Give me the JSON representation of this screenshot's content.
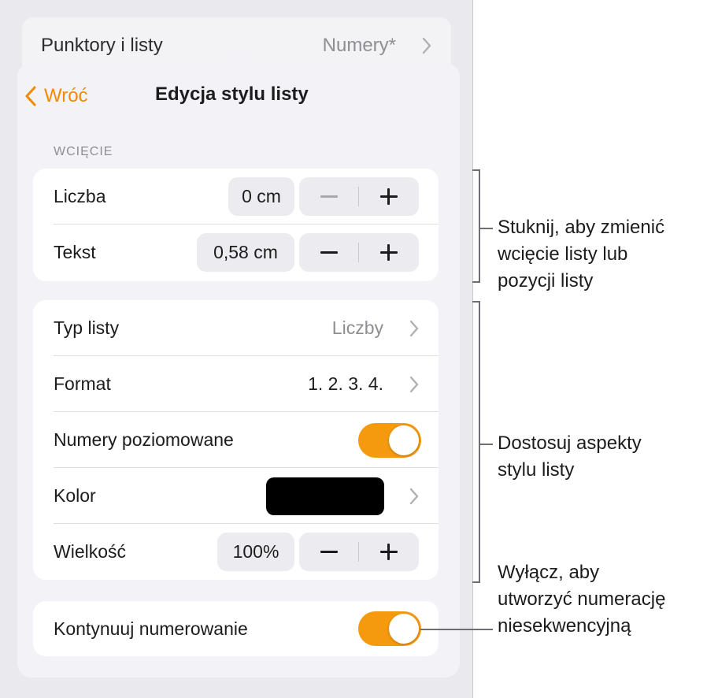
{
  "background_row": {
    "label": "Punktory i listy",
    "value": "Numery*"
  },
  "nav": {
    "back_label": "Wróć",
    "title": "Edycja stylu listy"
  },
  "indent_section": {
    "header": "WCIĘCIE",
    "rows": [
      {
        "label": "Liczba",
        "value": "0 cm",
        "minus_enabled": false
      },
      {
        "label": "Tekst",
        "value": "0,58 cm",
        "minus_enabled": true
      }
    ]
  },
  "style_section": {
    "list_type": {
      "label": "Typ listy",
      "value": "Liczby"
    },
    "format": {
      "label": "Format",
      "value": "1. 2. 3. 4."
    },
    "tiered": {
      "label": "Numery poziomowane",
      "on": true
    },
    "color": {
      "label": "Kolor",
      "value": "#000000"
    },
    "size": {
      "label": "Wielkość",
      "value": "100%"
    }
  },
  "continue": {
    "label": "Kontynuuj numerowanie",
    "on": true
  },
  "callouts": {
    "indent": [
      "Stuknij, aby zmienić",
      "wcięcie listy lub",
      "pozycji listy"
    ],
    "style": [
      "Dostosuj aspekty",
      "stylu listy"
    ],
    "continue": [
      "Wyłącz, aby",
      "utworzyć numerację",
      "niesekwencyjną"
    ]
  },
  "colors": {
    "accent": "#f08a00",
    "toggle_on": "#f59a0f"
  }
}
